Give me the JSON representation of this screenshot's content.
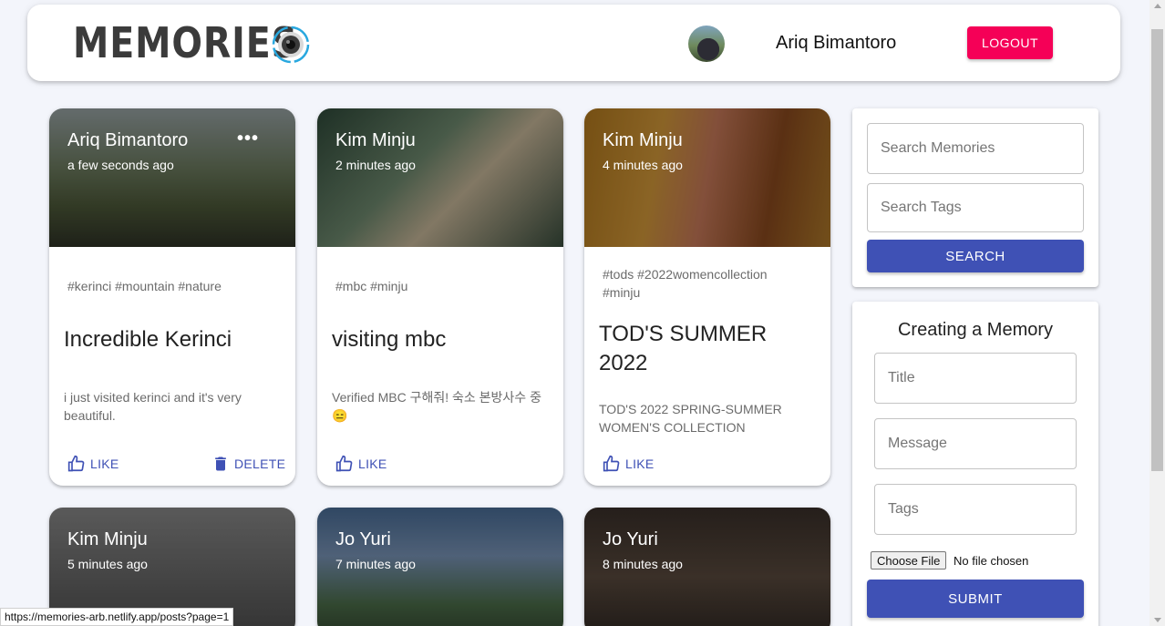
{
  "header": {
    "logo_text": "MEMORIES",
    "username": "Ariq Bimantoro",
    "logout_label": "LOGOUT"
  },
  "posts": [
    {
      "creator": "Ariq Bimantoro",
      "time": "a few seconds ago",
      "tags": "#kerinci #mountain #nature",
      "title": "Incredible Kerinci",
      "message": "i just visited kerinci and it's very beautiful.",
      "like_label": "LIKE",
      "delete_label": "DELETE"
    },
    {
      "creator": "Kim Minju",
      "time": "2 minutes ago",
      "tags": "#mbc #minju",
      "title": "visiting mbc",
      "message": "Verified MBC 구해줘! 숙소 본방사수 중😑",
      "like_label": "LIKE"
    },
    {
      "creator": "Kim Minju",
      "time": "4 minutes ago",
      "tags": "#tods #2022womencollection #minju",
      "title": "TOD'S SUMMER 2022",
      "message": "TOD'S 2022 SPRING-SUMMER WOMEN'S COLLECTION",
      "like_label": "LIKE"
    },
    {
      "creator": "Kim Minju",
      "time": "5 minutes ago"
    },
    {
      "creator": "Jo Yuri",
      "time": "7 minutes ago"
    },
    {
      "creator": "Jo Yuri",
      "time": "8 minutes ago"
    }
  ],
  "search": {
    "memories_placeholder": "Search Memories",
    "tags_placeholder": "Search Tags",
    "button_label": "SEARCH"
  },
  "form": {
    "title": "Creating a Memory",
    "title_placeholder": "Title",
    "message_placeholder": "Message",
    "tags_placeholder": "Tags",
    "choose_file_label": "Choose File",
    "no_file_text": "No file chosen",
    "submit_label": "SUBMIT"
  },
  "status_url": "https://memories-arb.netlify.app/posts?page=1",
  "colors": {
    "primary": "#3f51b5",
    "secondary": "#f50057"
  }
}
